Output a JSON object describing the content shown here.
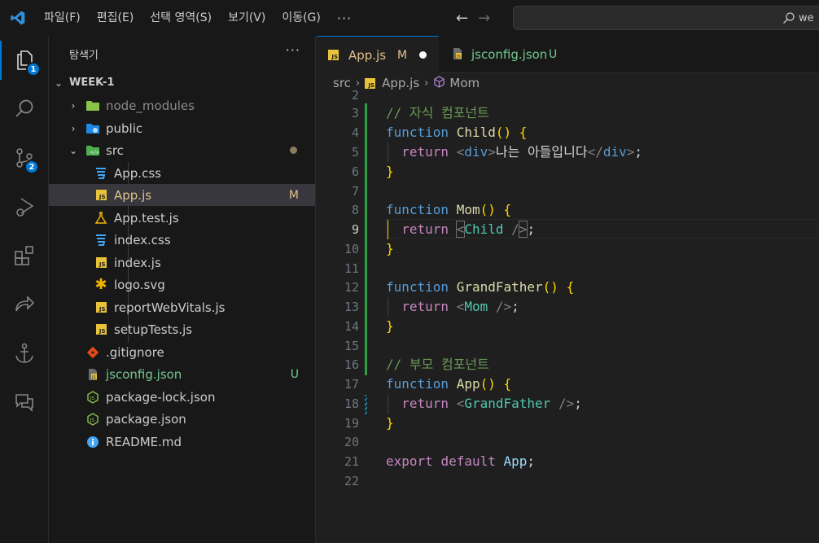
{
  "menu": [
    "파일(F)",
    "편집(E)",
    "선택 영역(S)",
    "보기(V)",
    "이동(G)"
  ],
  "menu_more": "···",
  "search": {
    "text": "we"
  },
  "activity": {
    "explorer_badge": "1",
    "scm_badge": "2"
  },
  "sidebar": {
    "title": "탐색기",
    "more": "···",
    "root": "WEEK-1",
    "items": [
      {
        "name": "node_modules",
        "status": ""
      },
      {
        "name": "public",
        "status": ""
      },
      {
        "name": "src",
        "status": ""
      },
      {
        "name": "App.css",
        "status": ""
      },
      {
        "name": "App.js",
        "status": "M"
      },
      {
        "name": "App.test.js",
        "status": ""
      },
      {
        "name": "index.css",
        "status": ""
      },
      {
        "name": "index.js",
        "status": ""
      },
      {
        "name": "logo.svg",
        "status": ""
      },
      {
        "name": "reportWebVitals.js",
        "status": ""
      },
      {
        "name": "setupTests.js",
        "status": ""
      },
      {
        "name": ".gitignore",
        "status": ""
      },
      {
        "name": "jsconfig.json",
        "status": "U"
      },
      {
        "name": "package-lock.json",
        "status": ""
      },
      {
        "name": "package.json",
        "status": ""
      },
      {
        "name": "README.md",
        "status": ""
      }
    ]
  },
  "tabs": [
    {
      "label": "App.js",
      "status": "M"
    },
    {
      "label": "jsconfig.json",
      "status": "U"
    }
  ],
  "breadcrumb": {
    "folder": "src",
    "file": "App.js",
    "symbol": "Mom"
  },
  "editor": {
    "line_numbers": [
      "2",
      "3",
      "4",
      "5",
      "6",
      "7",
      "8",
      "9",
      "10",
      "11",
      "12",
      "13",
      "14",
      "15",
      "16",
      "17",
      "18",
      "19",
      "20",
      "21",
      "22"
    ],
    "line3_comment": "// 자식 컴포넌트",
    "line16_comment": "// 부모 컴포넌트",
    "kw_function": "function",
    "kw_return": "return",
    "kw_export": "export",
    "kw_default": "default",
    "fn_child": "Child",
    "fn_mom": "Mom",
    "fn_grandfather": "GrandFather",
    "fn_app": "App",
    "tag_div": "div",
    "text_child": "나는 아들입니다",
    "export_name": "App"
  }
}
